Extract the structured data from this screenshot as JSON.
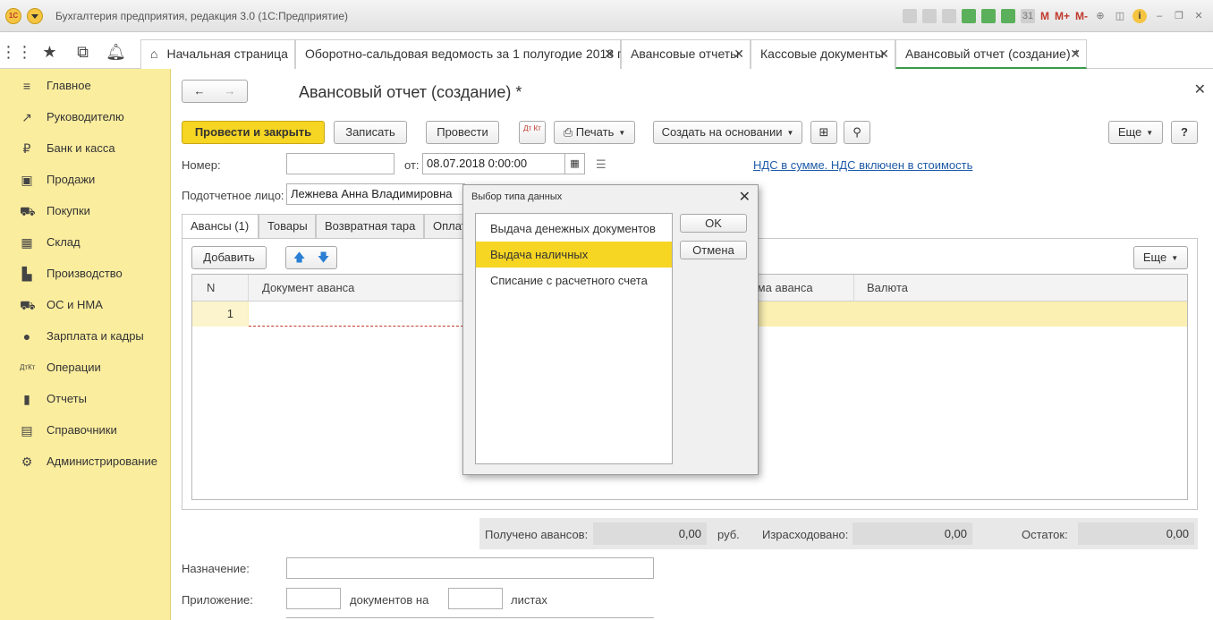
{
  "window": {
    "title": "Бухгалтерия предприятия, редакция 3.0  (1С:Предприятие)",
    "logo": "1С",
    "toolbar_icons": [
      "save-icon",
      "print-icon",
      "preview-icon",
      "upload-icon",
      "download-icon",
      "calculator-icon",
      "calendar-icon"
    ],
    "memory_labels": [
      "M",
      "M+",
      "M-"
    ]
  },
  "tabs": [
    {
      "label": "Начальная страница",
      "closable": false
    },
    {
      "label": "Оборотно-сальдовая ведомость за 1 полугодие 2018 г.",
      "closable": true
    },
    {
      "label": "Авансовые отчеты",
      "closable": true
    },
    {
      "label": "Кассовые документы",
      "closable": true
    },
    {
      "label": "Авансовый отчет (создание) *",
      "closable": true,
      "active": true
    }
  ],
  "sidebar": {
    "items": [
      {
        "label": "Главное",
        "icon": "menu-icon"
      },
      {
        "label": "Руководителю",
        "icon": "chart-trend-icon"
      },
      {
        "label": "Банк и касса",
        "icon": "ruble-icon"
      },
      {
        "label": "Продажи",
        "icon": "bag-icon"
      },
      {
        "label": "Покупки",
        "icon": "cart-icon"
      },
      {
        "label": "Склад",
        "icon": "warehouse-icon"
      },
      {
        "label": "Производство",
        "icon": "factory-icon"
      },
      {
        "label": "ОС и НМА",
        "icon": "truck-icon"
      },
      {
        "label": "Зарплата и кадры",
        "icon": "person-icon"
      },
      {
        "label": "Операции",
        "icon": "dt-kt-icon"
      },
      {
        "label": "Отчеты",
        "icon": "bar-chart-icon"
      },
      {
        "label": "Справочники",
        "icon": "book-icon"
      },
      {
        "label": "Администрирование",
        "icon": "gear-icon"
      }
    ]
  },
  "form": {
    "title": "Авансовый отчет (создание) *",
    "buttons": {
      "post_close": "Провести и закрыть",
      "save": "Записать",
      "post": "Провести",
      "dtkt": "Дт Кт",
      "print": "Печать",
      "create_based": "Создать на основании",
      "more": "Еще",
      "help": "?"
    },
    "number_label": "Номер:",
    "number_value": "",
    "date_label": "от:",
    "date_value": "08.07.2018  0:00:00",
    "vat_link": "НДС в сумме. НДС включен в стоимость",
    "person_label": "Подотчетное лицо:",
    "person_value": "Лежнева Анна Владимировна",
    "inner_tabs": [
      "Авансы (1)",
      "Товары",
      "Возвратная тара",
      "Оплата"
    ],
    "add_button": "Добавить",
    "table_more": "Еще",
    "table": {
      "columns": [
        "N",
        "Документ аванса",
        "Сумма аванса",
        "Валюта"
      ],
      "rows": [
        {
          "n": "1",
          "document": "",
          "amount": "",
          "currency": ""
        }
      ]
    },
    "totals": {
      "received_label": "Получено авансов:",
      "received_value": "0,00",
      "currency": "руб.",
      "spent_label": "Израсходовано:",
      "spent_value": "0,00",
      "remainder_label": "Остаток:",
      "remainder_value": "0,00"
    },
    "purpose_label": "Назначение:",
    "purpose_value": "",
    "attachment_label": "Приложение:",
    "docs_label": "документов на",
    "sheets_label": "листах"
  },
  "dialog": {
    "title": "Выбор типа данных",
    "items": [
      "Выдача денежных документов",
      "Выдача наличных",
      "Списание с расчетного счета"
    ],
    "selected_index": 1,
    "ok": "OK",
    "cancel": "Отмена"
  }
}
